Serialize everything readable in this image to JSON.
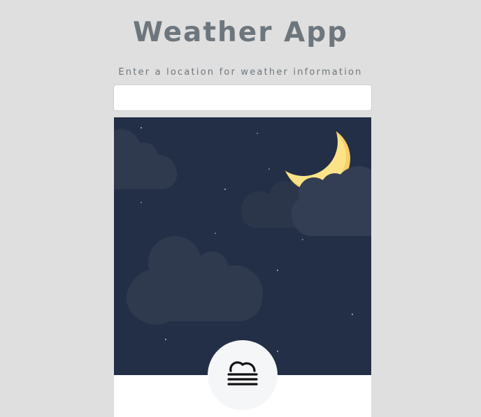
{
  "app": {
    "title": "Weather App",
    "subtitle": "Enter a location for weather information"
  },
  "search": {
    "value": "",
    "placeholder": ""
  },
  "scene": {
    "time_of_day": "night",
    "sky_color": "#232f46",
    "cloud_color": "#2f3a4f",
    "moon_color": "#fde387",
    "moon_shadow_color": "#f6cf6a",
    "star_color": "#9ea6b8"
  },
  "weather_icon": {
    "name": "fog-icon",
    "background_color": "#f5f6f8"
  }
}
